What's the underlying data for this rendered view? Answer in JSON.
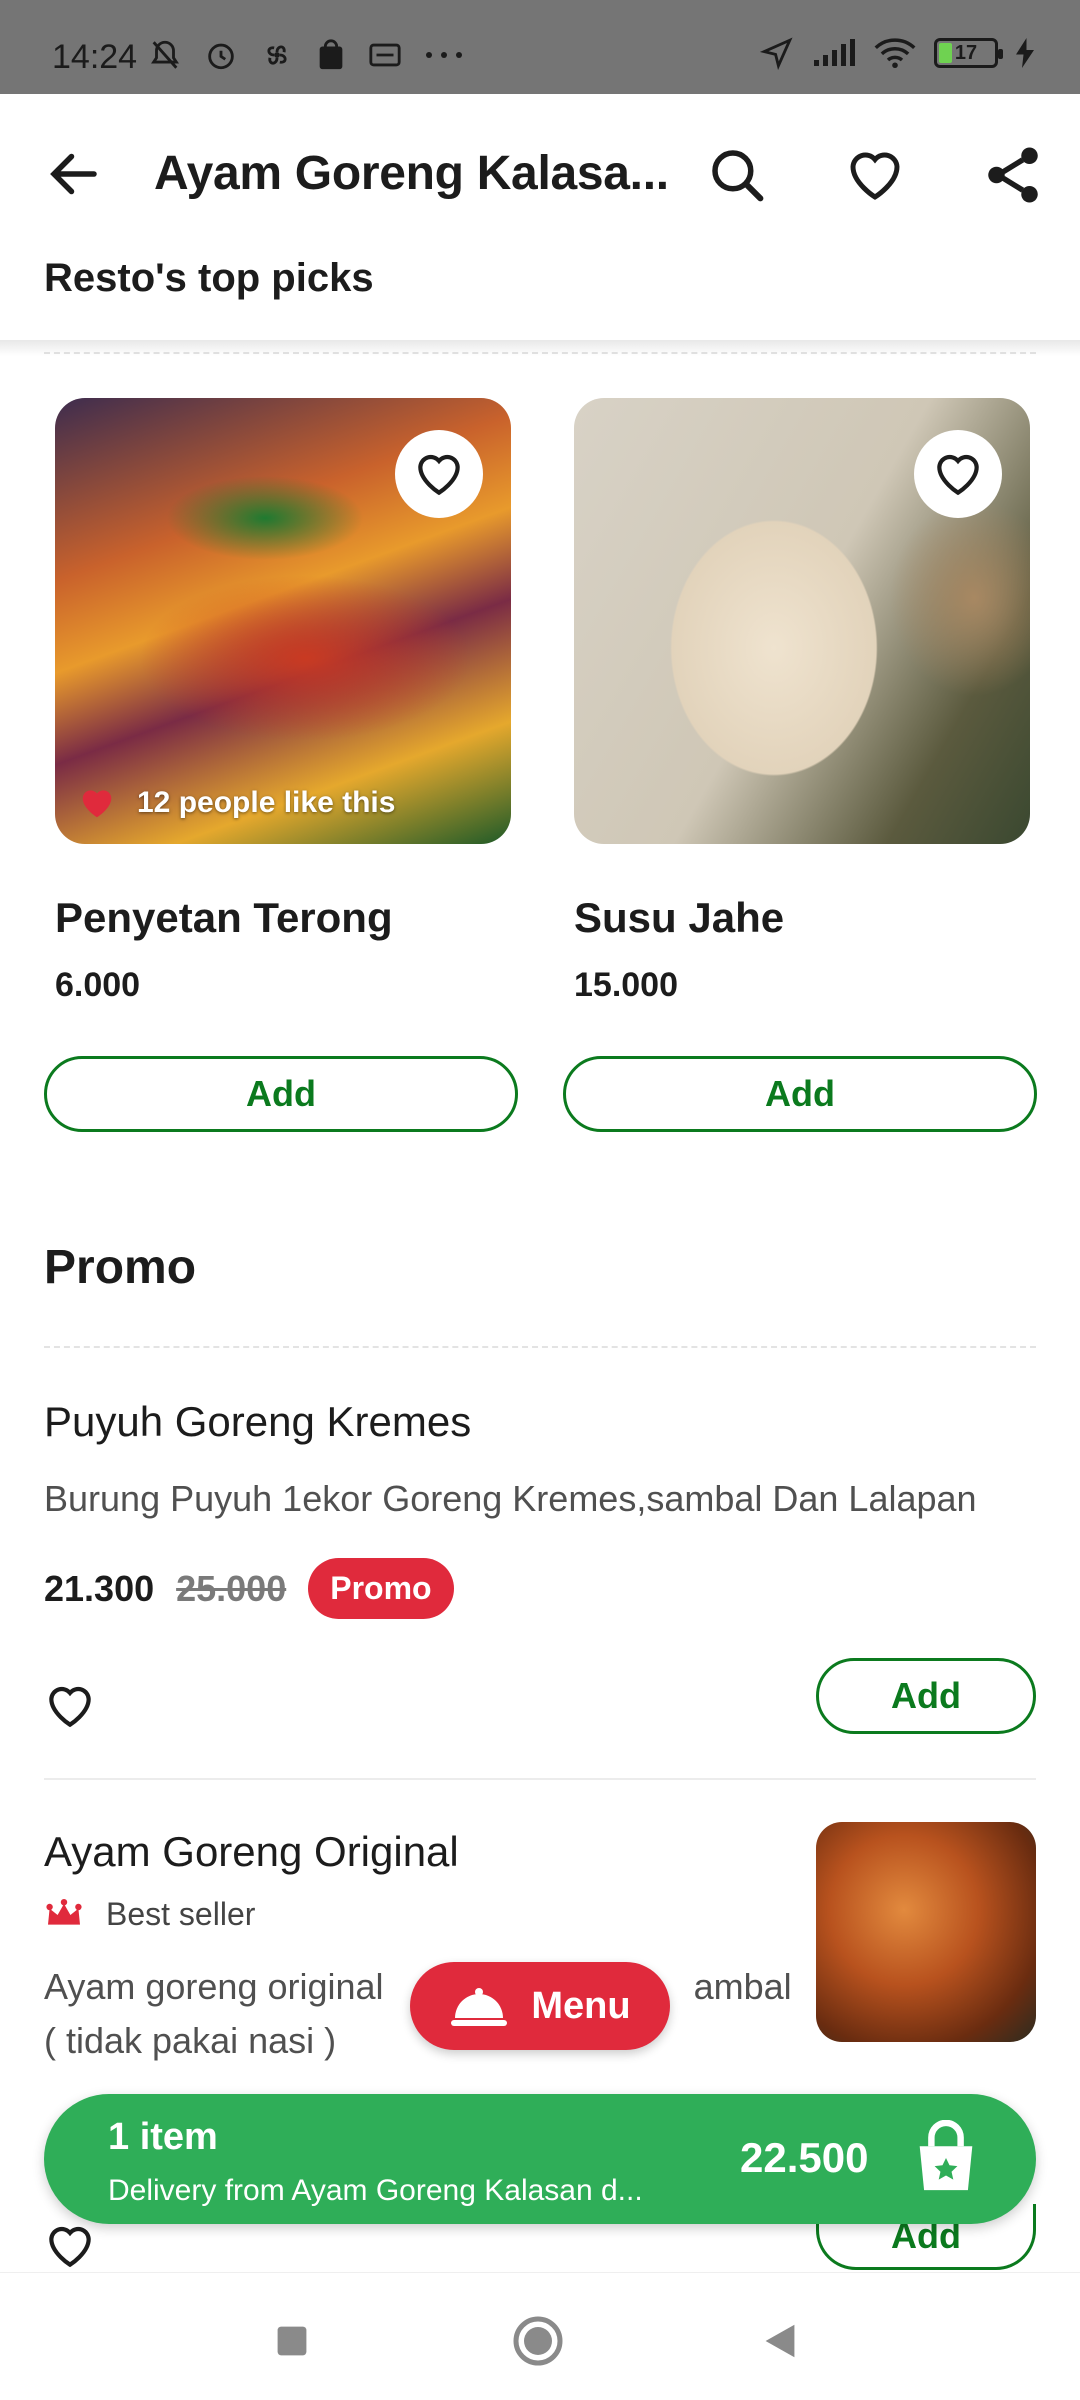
{
  "status_bar": {
    "time": "14:24",
    "battery": "17"
  },
  "header": {
    "title": "Ayam Goreng Kalasa...",
    "subtitle": "Resto's top picks"
  },
  "top_picks": [
    {
      "name": "Penyetan Terong",
      "price": "6.000",
      "likes": "12 people like this",
      "add_label": "Add"
    },
    {
      "name": "Susu Jahe",
      "price": "15.000",
      "add_label": "Add"
    }
  ],
  "promo": {
    "title": "Promo",
    "items": [
      {
        "name": "Puyuh Goreng Kremes",
        "description": "Burung Puyuh 1ekor Goreng Kremes,sambal Dan Lalapan",
        "price": "21.300",
        "old_price": "25.000",
        "badge": "Promo",
        "add_label": "Add"
      },
      {
        "name": "Ayam Goreng Original",
        "tag": "Best seller",
        "description_line1": "Ayam goreng original",
        "description_line1_tail": "ambal",
        "description_line2": "( tidak pakai nasi )",
        "add_label": "Add"
      }
    ]
  },
  "menu_fab": {
    "label": "Menu"
  },
  "cart": {
    "count": "1 item",
    "description": "Delivery from Ayam Goreng Kalasan d...",
    "total": "22.500"
  },
  "colors": {
    "brand_green": "#0b7a1e",
    "cart_green": "#2fae58",
    "promo_red": "#e02a3c"
  }
}
